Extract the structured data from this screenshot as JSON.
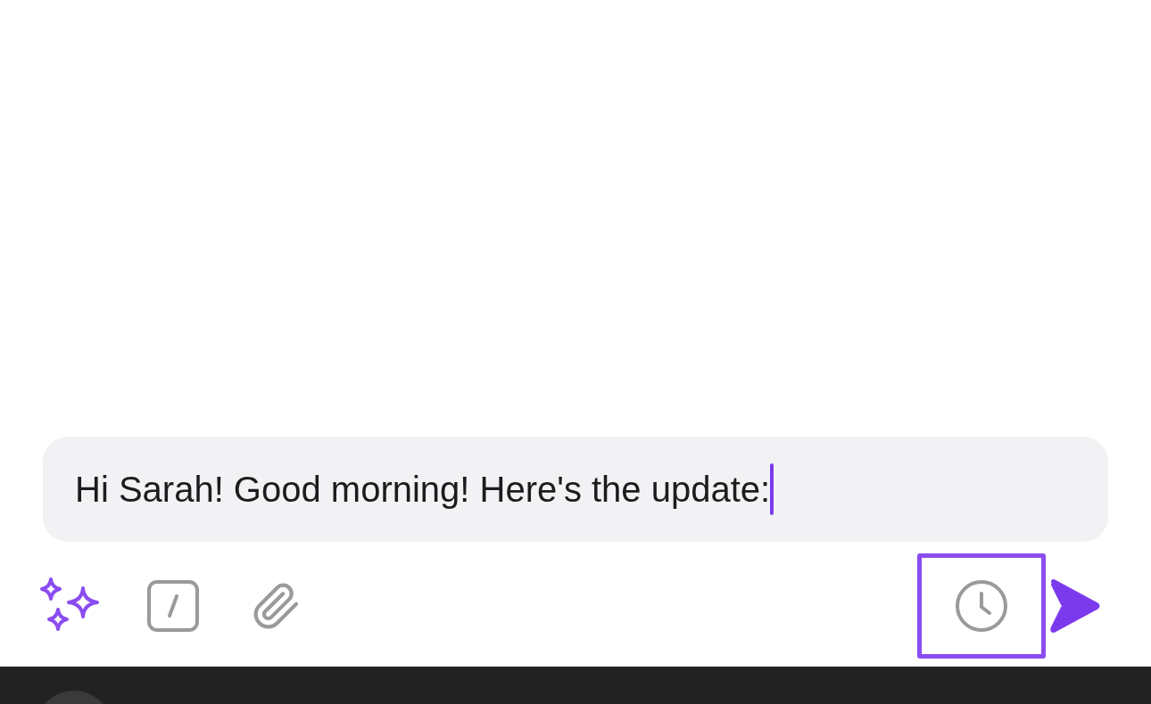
{
  "composer": {
    "value": "Hi Sarah! Good morning! Here's the update:",
    "focused": true
  },
  "toolbar_left": [
    {
      "kind": "sparkles",
      "highlighted": false
    },
    {
      "kind": "slash",
      "highlighted": false
    },
    {
      "kind": "attach",
      "highlighted": false
    }
  ],
  "toolbar_right": [
    {
      "kind": "schedule",
      "highlighted": true
    },
    {
      "kind": "send",
      "highlighted": false
    }
  ]
}
